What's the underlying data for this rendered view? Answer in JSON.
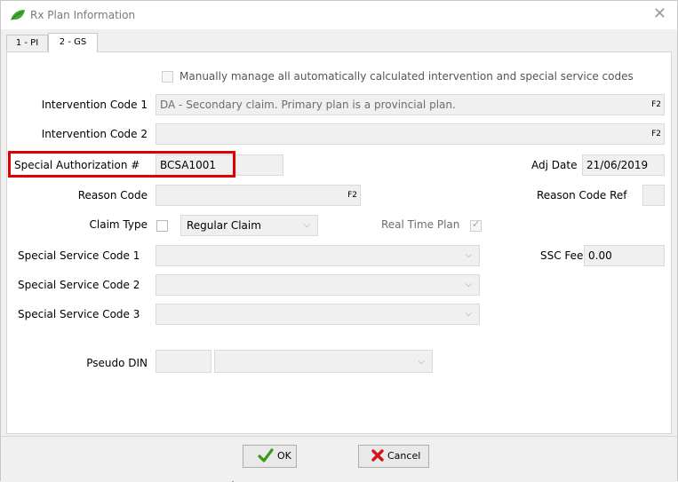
{
  "window": {
    "title": "Rx Plan Information",
    "close_glyph": "✕"
  },
  "tabs": [
    {
      "label": "1 - PI"
    },
    {
      "label": "2 - GS"
    }
  ],
  "form": {
    "manual_manage_label": "Manually manage all automatically calculated intervention and special service codes",
    "intervention_code_1": {
      "label": "Intervention Code 1",
      "value": "DA - Secondary claim. Primary plan is a provincial plan.",
      "key_hint": "F2"
    },
    "intervention_code_2": {
      "label": "Intervention Code 2",
      "value": "",
      "key_hint": "F2"
    },
    "special_authorization": {
      "label": "Special Authorization #",
      "value": "BCSA1001"
    },
    "adj_date": {
      "label": "Adj Date",
      "value": "21/06/2019"
    },
    "reason_code": {
      "label": "Reason Code",
      "value": "",
      "key_hint": "F2"
    },
    "reason_code_ref": {
      "label": "Reason Code Ref",
      "value": ""
    },
    "claim_type": {
      "label": "Claim Type",
      "value": "Regular Claim"
    },
    "real_time_plan": {
      "label": "Real Time Plan",
      "checked": true
    },
    "special_service_code_1": {
      "label": "Special Service Code 1",
      "value": ""
    },
    "special_service_code_2": {
      "label": "Special Service Code 2",
      "value": ""
    },
    "special_service_code_3": {
      "label": "Special Service Code 3",
      "value": ""
    },
    "ssc_fee": {
      "label": "SSC Fee",
      "value": "0.00"
    },
    "pseudo_din": {
      "label": "Pseudo DIN",
      "value": "",
      "select_value": ""
    }
  },
  "buttons": {
    "ok_label": "OK",
    "cancel_label": "Cancel"
  },
  "colors": {
    "highlight": "#e00000",
    "ok_check": "#3c9a1a",
    "cancel_x": "#d0141a",
    "app_leaf": "#3daa2e"
  },
  "icons": {
    "app": "leaf-icon",
    "ok": "checkmark-icon",
    "cancel": "x-mark-icon",
    "close": "close-icon",
    "dropdown": "chevron-down-icon"
  }
}
